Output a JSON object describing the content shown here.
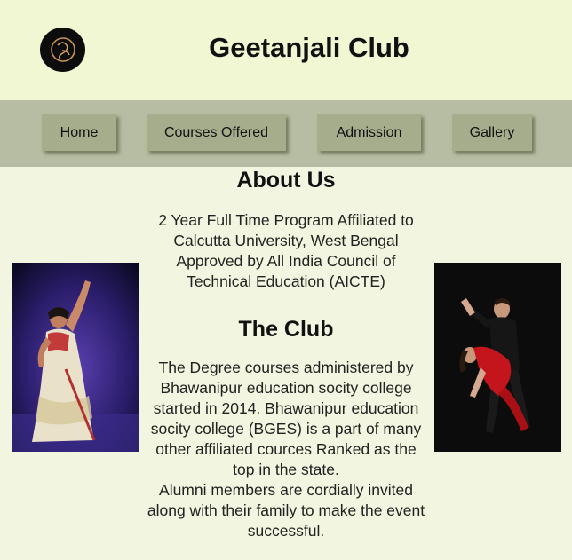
{
  "header": {
    "title": "Geetanjali Club",
    "logo_icon": "club-logo-icon"
  },
  "nav": {
    "items": [
      {
        "label": "Home"
      },
      {
        "label": "Courses Offered"
      },
      {
        "label": "Admission"
      },
      {
        "label": "Gallery"
      }
    ]
  },
  "about": {
    "heading": "About Us",
    "lines": [
      "2 Year Full Time Program Affiliated to",
      "Calcutta University, West Bengal",
      "Approved by All India Council of",
      "Technical Education (AICTE)"
    ]
  },
  "club": {
    "heading": "The Club",
    "lines": [
      "The Degree courses administered by",
      "Bhawanipur education socity college",
      "started in 2014. Bhawanipur education",
      "socity college (BGES) is a part of many",
      "other affiliated cources Ranked as the",
      "top in the state.",
      "Alumni members are cordially invited",
      "along with their family to make the event",
      "successful."
    ]
  },
  "images": {
    "left": "classical-dancer-photo",
    "right": "ballroom-dance-couple-photo"
  },
  "colors": {
    "header_bg": "#f1f7d3",
    "nav_bg": "#b7bda2",
    "button_bg": "#a6ad8d",
    "page_bg": "#f2f5df"
  }
}
